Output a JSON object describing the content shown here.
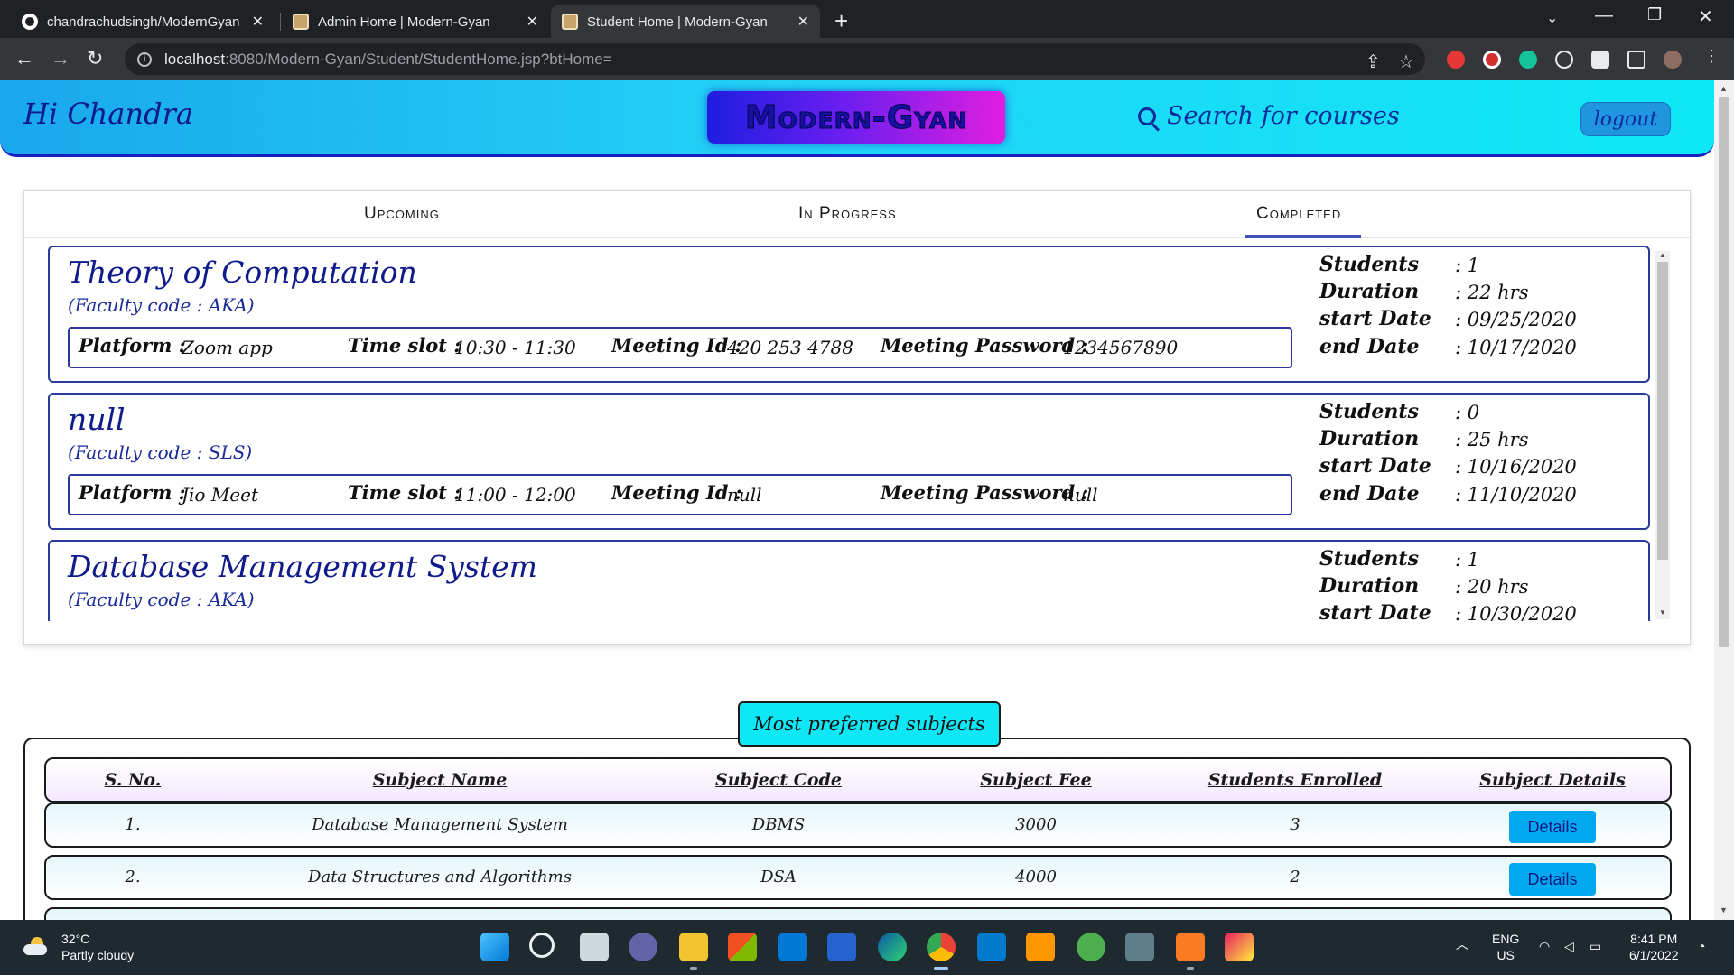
{
  "browser": {
    "tabs": [
      {
        "title": "chandrachudsingh/ModernGyan",
        "favicon": "github-icon",
        "active": false
      },
      {
        "title": "Admin Home | Modern-Gyan",
        "favicon": "site-icon",
        "active": false
      },
      {
        "title": "Student Home | Modern-Gyan",
        "favicon": "site-icon",
        "active": true
      }
    ],
    "url_host": "localhost",
    "url_path": ":8080/Modern-Gyan/Student/StudentHome.jsp?btHome="
  },
  "header": {
    "greeting": "Hi Chandra",
    "brand": "Modern-Gyan",
    "search_label": "Search for courses",
    "logout_label": "logout",
    "colors": {
      "gradient_start": "#1aa7ec",
      "gradient_end": "#0ee8f6",
      "accent": "#0f1a8c"
    }
  },
  "course_tabs": [
    {
      "label": "Upcoming",
      "active": false
    },
    {
      "label": "In Progress",
      "active": false
    },
    {
      "label": "Completed",
      "active": true
    }
  ],
  "labels": {
    "platform": "Platform :",
    "time_slot": "Time slot :",
    "meeting_id": "Meeting Id :",
    "meeting_password": "Meeting Password :",
    "students": "Students",
    "duration": "Duration",
    "start_date": "start Date",
    "end_date": "end Date"
  },
  "courses": [
    {
      "title": "Theory of Computation",
      "faculty": "(Faculty code : AKA)",
      "platform": "Zoom app",
      "time_slot": "10:30 - 11:30",
      "meeting_id": "420 253 4788",
      "meeting_password": "1234567890",
      "students": ": 1",
      "duration": ": 22 hrs",
      "start_date": ": 09/25/2020",
      "end_date": ": 10/17/2020"
    },
    {
      "title": "null",
      "faculty": "(Faculty code : SLS)",
      "platform": "Jio Meet",
      "time_slot": "11:00 - 12:00",
      "meeting_id": "null",
      "meeting_password": "null",
      "students": ": 0",
      "duration": ": 25 hrs",
      "start_date": ": 10/16/2020",
      "end_date": ": 11/10/2020"
    },
    {
      "title": "Database Management System",
      "faculty": "(Faculty code : AKA)",
      "students": ": 1",
      "duration": ": 20 hrs",
      "start_date": ": 10/30/2020"
    }
  ],
  "subjects": {
    "title": "Most preferred subjects",
    "columns": [
      "S. No.",
      "Subject Name",
      "Subject Code",
      "Subject Fee",
      "Students Enrolled",
      "Subject Details"
    ],
    "rows": [
      {
        "sno": "1.",
        "name": "Database Management System",
        "code": "DBMS",
        "fee": "3000",
        "enrolled": "3",
        "action": "Details"
      },
      {
        "sno": "2.",
        "name": "Data Structures and Algorithms",
        "code": "DSA",
        "fee": "4000",
        "enrolled": "2",
        "action": "Details"
      }
    ]
  },
  "taskbar": {
    "temperature": "32°C",
    "weather": "Partly cloudy",
    "lang_top": "ENG",
    "lang_bottom": "US",
    "time": "8:41 PM",
    "date": "6/1/2022"
  }
}
